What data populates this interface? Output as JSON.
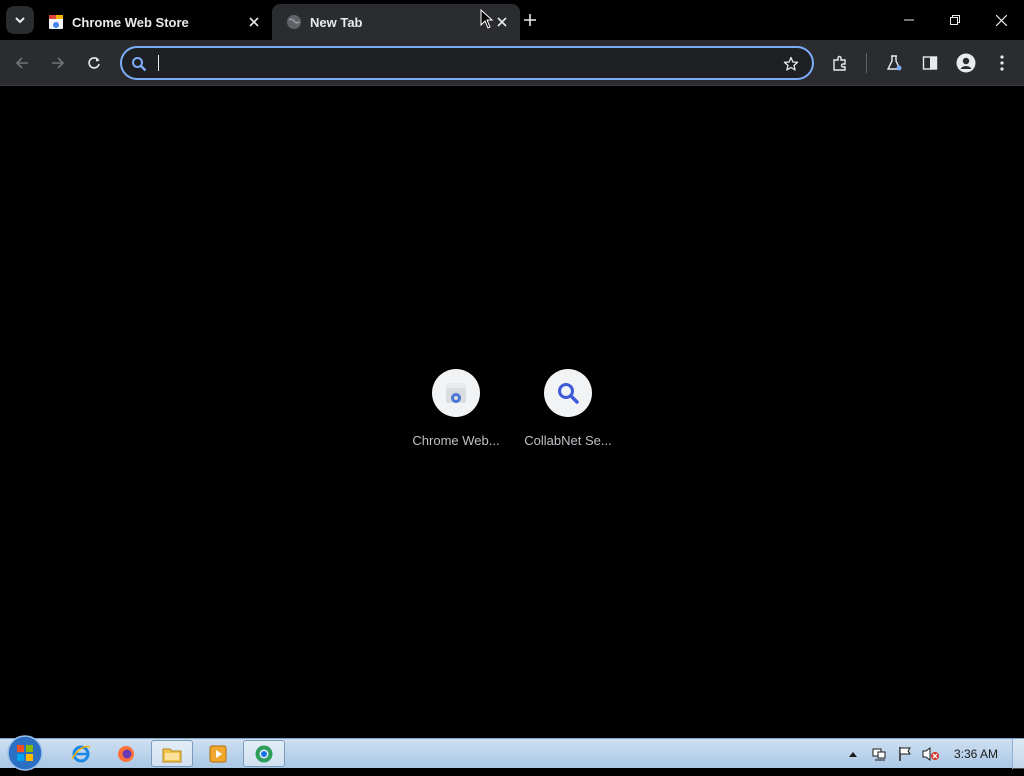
{
  "tabs": [
    {
      "title": "Chrome Web Store",
      "favicon": "chrome-web-store-icon",
      "active": false
    },
    {
      "title": "New Tab",
      "favicon": "globe-icon",
      "active": true
    }
  ],
  "omnibox": {
    "value": "",
    "placeholder": ""
  },
  "shortcuts": [
    {
      "label": "Chrome Web...",
      "icon": "chrome-web-store-icon"
    },
    {
      "label": "CollabNet Se...",
      "icon": "search-icon"
    }
  ],
  "taskbar": {
    "clock": "3:36 AM",
    "apps": [
      "internet-explorer-icon",
      "firefox-icon",
      "file-explorer-icon",
      "media-player-icon",
      "chrome-icon"
    ]
  },
  "colors": {
    "accent": "#7cacf8",
    "toolbar": "#2b2c2f",
    "background": "#000000"
  }
}
